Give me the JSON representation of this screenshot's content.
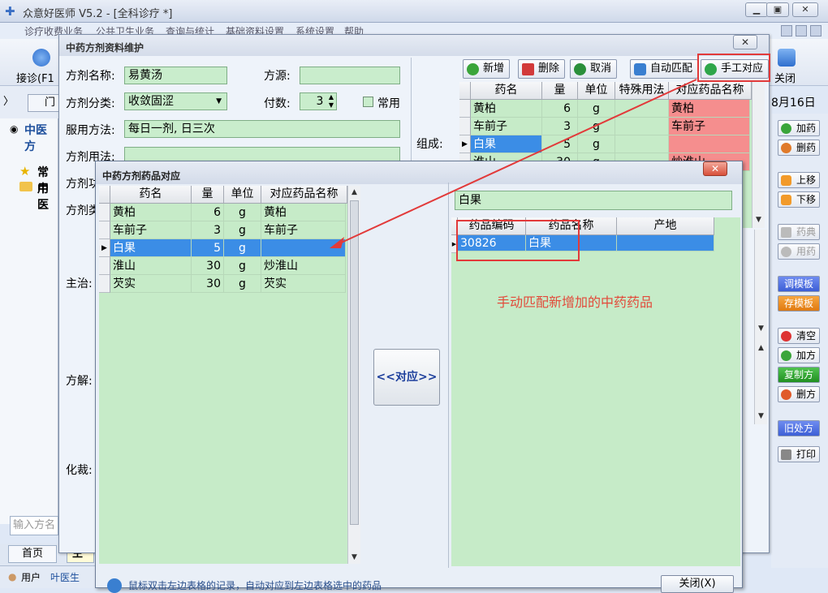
{
  "app": {
    "title": "众意好医师 V5.2 - [全科诊疗 *]",
    "min": "▭",
    "max": "▣",
    "close": "✕"
  },
  "menu": [
    "诊疗收费业务",
    "公共卫生业务",
    "查询与统计",
    "基础资料设置",
    "系统设置",
    "帮助"
  ],
  "toolbar": {
    "reception": "接诊(F1",
    "close": "关闭"
  },
  "bg": {
    "date": "8月16日",
    "tab_prefix": "门",
    "tree_title": "中医方",
    "tree_nodes": [
      "常用",
      "中医"
    ],
    "search_placeholder": "输入方名",
    "bottom_tabs": [
      "首页",
      "主"
    ],
    "status": [
      "用户",
      "叶医生"
    ],
    "hint": "鼠标双击左边表格的记录，自动对应到左边表格选中的药品"
  },
  "right_buttons": {
    "add_drug": "加药",
    "del_drug": "删药",
    "up": "上移",
    "down": "下移",
    "pharmacopoeia": "药典",
    "usage": "用药",
    "load_template": "调模板",
    "save_template": "存模板",
    "clear": "清空",
    "add_rx": "加方",
    "copy_rx": "复制方",
    "del_rx": "删方",
    "old_rx": "旧处方",
    "print": "打印"
  },
  "dlg1": {
    "title": "中药方剂资料维护",
    "labels": {
      "name": "方剂名称:",
      "source": "方源:",
      "category": "方剂分类:",
      "doses": "付数:",
      "common": "常用",
      "take": "服用方法:",
      "usage": "方剂用法:",
      "function": "方剂功",
      "type": "方剂类",
      "compose": "组成:",
      "indication": "主治:",
      "explain": "方解:",
      "variation": "化裁:"
    },
    "values": {
      "name": "易黄汤",
      "source": "",
      "category": "收敛固涩",
      "doses": "3",
      "take": "每日一剂, 日三次",
      "usage": ""
    },
    "buttons": {
      "add": "新增",
      "delete": "删除",
      "cancel": "取消",
      "auto": "自动匹配",
      "manual": "手工对应"
    },
    "grid": {
      "headers": [
        "药名",
        "量",
        "单位",
        "特殊用法",
        "对应药品名称"
      ],
      "rows": [
        {
          "name": "黄柏",
          "qty": "6",
          "unit": "g",
          "special": "",
          "match": "黄柏"
        },
        {
          "name": "车前子",
          "qty": "3",
          "unit": "g",
          "special": "",
          "match": "车前子"
        },
        {
          "name": "白果",
          "qty": "5",
          "unit": "g",
          "special": "",
          "match": ""
        },
        {
          "name": "淮山",
          "qty": "30",
          "unit": "g",
          "special": "",
          "match": "炒淮山"
        }
      ]
    }
  },
  "dlg2": {
    "title": "中药方剂药品对应",
    "left_headers": [
      "药名",
      "量",
      "单位",
      "对应药品名称"
    ],
    "left_rows": [
      {
        "name": "黄柏",
        "qty": "6",
        "unit": "g",
        "match": "黄柏"
      },
      {
        "name": "车前子",
        "qty": "3",
        "unit": "g",
        "match": "车前子"
      },
      {
        "name": "白果",
        "qty": "5",
        "unit": "g",
        "match": ""
      },
      {
        "name": "淮山",
        "qty": "30",
        "unit": "g",
        "match": "炒淮山"
      },
      {
        "name": "芡实",
        "qty": "30",
        "unit": "g",
        "match": "芡实"
      }
    ],
    "match_button": "<<对应>>",
    "search_value": "白果",
    "right_headers": [
      "药品编码",
      "药品名称",
      "产地"
    ],
    "right_rows": [
      {
        "code": "30826",
        "name": "白果",
        "origin": ""
      }
    ],
    "annotation": "手动匹配新增加的中药药品",
    "close": "关闭(X)"
  },
  "colors": {
    "grid": "#c6ebc8",
    "pink": "#f58e8e",
    "selected": "#3b8de6",
    "annotation": "#e24a3a"
  }
}
